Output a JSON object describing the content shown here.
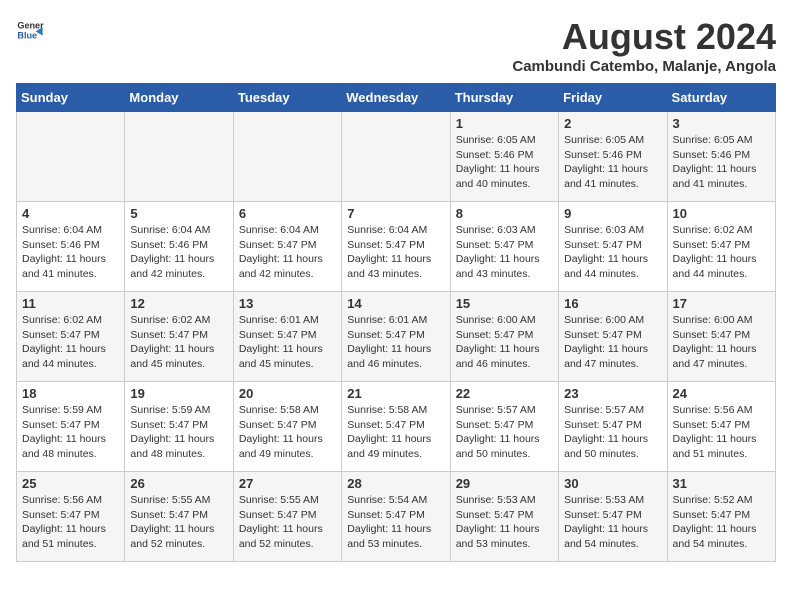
{
  "header": {
    "logo_general": "General",
    "logo_blue": "Blue",
    "title": "August 2024",
    "subtitle": "Cambundi Catembo, Malanje, Angola"
  },
  "days_of_week": [
    "Sunday",
    "Monday",
    "Tuesday",
    "Wednesday",
    "Thursday",
    "Friday",
    "Saturday"
  ],
  "weeks": [
    [
      {
        "day": "",
        "text": ""
      },
      {
        "day": "",
        "text": ""
      },
      {
        "day": "",
        "text": ""
      },
      {
        "day": "",
        "text": ""
      },
      {
        "day": "1",
        "text": "Sunrise: 6:05 AM\nSunset: 5:46 PM\nDaylight: 11 hours\nand 40 minutes."
      },
      {
        "day": "2",
        "text": "Sunrise: 6:05 AM\nSunset: 5:46 PM\nDaylight: 11 hours\nand 41 minutes."
      },
      {
        "day": "3",
        "text": "Sunrise: 6:05 AM\nSunset: 5:46 PM\nDaylight: 11 hours\nand 41 minutes."
      }
    ],
    [
      {
        "day": "4",
        "text": "Sunrise: 6:04 AM\nSunset: 5:46 PM\nDaylight: 11 hours\nand 41 minutes."
      },
      {
        "day": "5",
        "text": "Sunrise: 6:04 AM\nSunset: 5:46 PM\nDaylight: 11 hours\nand 42 minutes."
      },
      {
        "day": "6",
        "text": "Sunrise: 6:04 AM\nSunset: 5:47 PM\nDaylight: 11 hours\nand 42 minutes."
      },
      {
        "day": "7",
        "text": "Sunrise: 6:04 AM\nSunset: 5:47 PM\nDaylight: 11 hours\nand 43 minutes."
      },
      {
        "day": "8",
        "text": "Sunrise: 6:03 AM\nSunset: 5:47 PM\nDaylight: 11 hours\nand 43 minutes."
      },
      {
        "day": "9",
        "text": "Sunrise: 6:03 AM\nSunset: 5:47 PM\nDaylight: 11 hours\nand 44 minutes."
      },
      {
        "day": "10",
        "text": "Sunrise: 6:02 AM\nSunset: 5:47 PM\nDaylight: 11 hours\nand 44 minutes."
      }
    ],
    [
      {
        "day": "11",
        "text": "Sunrise: 6:02 AM\nSunset: 5:47 PM\nDaylight: 11 hours\nand 44 minutes."
      },
      {
        "day": "12",
        "text": "Sunrise: 6:02 AM\nSunset: 5:47 PM\nDaylight: 11 hours\nand 45 minutes."
      },
      {
        "day": "13",
        "text": "Sunrise: 6:01 AM\nSunset: 5:47 PM\nDaylight: 11 hours\nand 45 minutes."
      },
      {
        "day": "14",
        "text": "Sunrise: 6:01 AM\nSunset: 5:47 PM\nDaylight: 11 hours\nand 46 minutes."
      },
      {
        "day": "15",
        "text": "Sunrise: 6:00 AM\nSunset: 5:47 PM\nDaylight: 11 hours\nand 46 minutes."
      },
      {
        "day": "16",
        "text": "Sunrise: 6:00 AM\nSunset: 5:47 PM\nDaylight: 11 hours\nand 47 minutes."
      },
      {
        "day": "17",
        "text": "Sunrise: 6:00 AM\nSunset: 5:47 PM\nDaylight: 11 hours\nand 47 minutes."
      }
    ],
    [
      {
        "day": "18",
        "text": "Sunrise: 5:59 AM\nSunset: 5:47 PM\nDaylight: 11 hours\nand 48 minutes."
      },
      {
        "day": "19",
        "text": "Sunrise: 5:59 AM\nSunset: 5:47 PM\nDaylight: 11 hours\nand 48 minutes."
      },
      {
        "day": "20",
        "text": "Sunrise: 5:58 AM\nSunset: 5:47 PM\nDaylight: 11 hours\nand 49 minutes."
      },
      {
        "day": "21",
        "text": "Sunrise: 5:58 AM\nSunset: 5:47 PM\nDaylight: 11 hours\nand 49 minutes."
      },
      {
        "day": "22",
        "text": "Sunrise: 5:57 AM\nSunset: 5:47 PM\nDaylight: 11 hours\nand 50 minutes."
      },
      {
        "day": "23",
        "text": "Sunrise: 5:57 AM\nSunset: 5:47 PM\nDaylight: 11 hours\nand 50 minutes."
      },
      {
        "day": "24",
        "text": "Sunrise: 5:56 AM\nSunset: 5:47 PM\nDaylight: 11 hours\nand 51 minutes."
      }
    ],
    [
      {
        "day": "25",
        "text": "Sunrise: 5:56 AM\nSunset: 5:47 PM\nDaylight: 11 hours\nand 51 minutes."
      },
      {
        "day": "26",
        "text": "Sunrise: 5:55 AM\nSunset: 5:47 PM\nDaylight: 11 hours\nand 52 minutes."
      },
      {
        "day": "27",
        "text": "Sunrise: 5:55 AM\nSunset: 5:47 PM\nDaylight: 11 hours\nand 52 minutes."
      },
      {
        "day": "28",
        "text": "Sunrise: 5:54 AM\nSunset: 5:47 PM\nDaylight: 11 hours\nand 53 minutes."
      },
      {
        "day": "29",
        "text": "Sunrise: 5:53 AM\nSunset: 5:47 PM\nDaylight: 11 hours\nand 53 minutes."
      },
      {
        "day": "30",
        "text": "Sunrise: 5:53 AM\nSunset: 5:47 PM\nDaylight: 11 hours\nand 54 minutes."
      },
      {
        "day": "31",
        "text": "Sunrise: 5:52 AM\nSunset: 5:47 PM\nDaylight: 11 hours\nand 54 minutes."
      }
    ]
  ]
}
